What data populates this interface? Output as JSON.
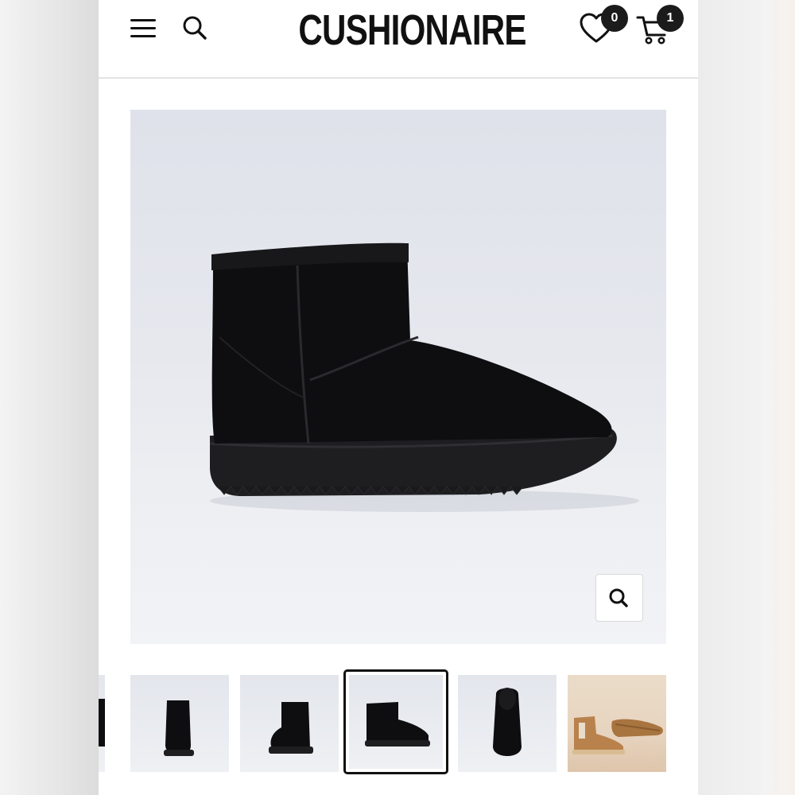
{
  "header": {
    "brand": "CUSHIONAIRE",
    "wishlist_count": "0",
    "cart_count": "1",
    "menu_icon": "hamburger-menu-icon",
    "search_icon": "search-icon",
    "wishlist_icon": "heart-icon",
    "cart_icon": "cart-icon"
  },
  "product_image": {
    "zoom_icon": "zoom-icon",
    "product_color": "#0d0d0d",
    "background_color": "#e4e7ed"
  },
  "thumbnails": {
    "count_visible": 6,
    "active_index": 2,
    "items": [
      "boot-front-view",
      "boot-back-view",
      "boot-side-view",
      "boot-top-view",
      "boot-lifestyle-chestnut"
    ]
  }
}
